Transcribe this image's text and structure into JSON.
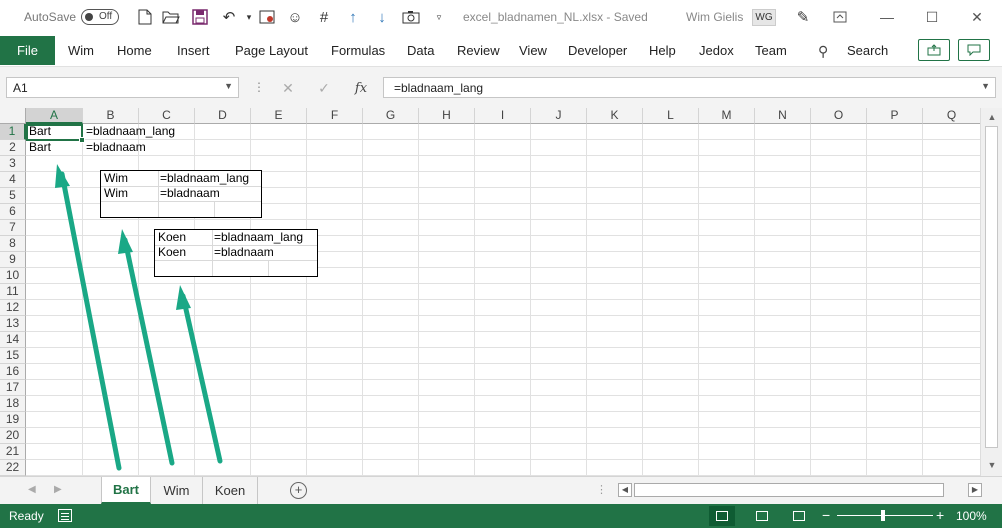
{
  "titlebar": {
    "autosave_label": "AutoSave",
    "autosave_state": "Off",
    "doc_title": "excel_bladnamen_NL.xlsx  -  Saved",
    "user_name": "Wim Gielis",
    "user_initials": "WG"
  },
  "ribbon": {
    "file": "File",
    "tabs": [
      "Wim",
      "Home",
      "Insert",
      "Page Layout",
      "Formulas",
      "Data",
      "Review",
      "View",
      "Developer",
      "Help",
      "Jedox",
      "Team"
    ],
    "search": "Search"
  },
  "formula_bar": {
    "name_box": "A1",
    "fx": "fx",
    "formula": "=bladnaam_lang"
  },
  "grid": {
    "columns": [
      "A",
      "B",
      "C",
      "D",
      "E",
      "F",
      "G",
      "H",
      "I",
      "J",
      "K",
      "L",
      "M",
      "N",
      "O",
      "P",
      "Q"
    ],
    "rows": [
      "1",
      "2",
      "3",
      "4",
      "5",
      "6",
      "7",
      "8",
      "9",
      "10",
      "11",
      "12",
      "13",
      "14",
      "15",
      "16",
      "17",
      "18",
      "19",
      "20",
      "21",
      "22"
    ],
    "cells": {
      "a1": "Bart",
      "b1": "=bladnaam_lang",
      "a2": "Bart",
      "b2": "=bladnaam"
    }
  },
  "pictures": {
    "wim": {
      "r1c1": "Wim",
      "r1c2": "=bladnaam_lang",
      "r2c1": "Wim",
      "r2c2": "=bladnaam"
    },
    "koen": {
      "r1c1": "Koen",
      "r1c2": "=bladnaam_lang",
      "r2c1": "Koen",
      "r2c2": "=bladnaam"
    }
  },
  "sheet_tabs": [
    "Bart",
    "Wim",
    "Koen"
  ],
  "status": {
    "ready": "Ready",
    "zoom": "100%"
  },
  "colors": {
    "excel_green": "#217346",
    "arrow": "#1aa886"
  }
}
